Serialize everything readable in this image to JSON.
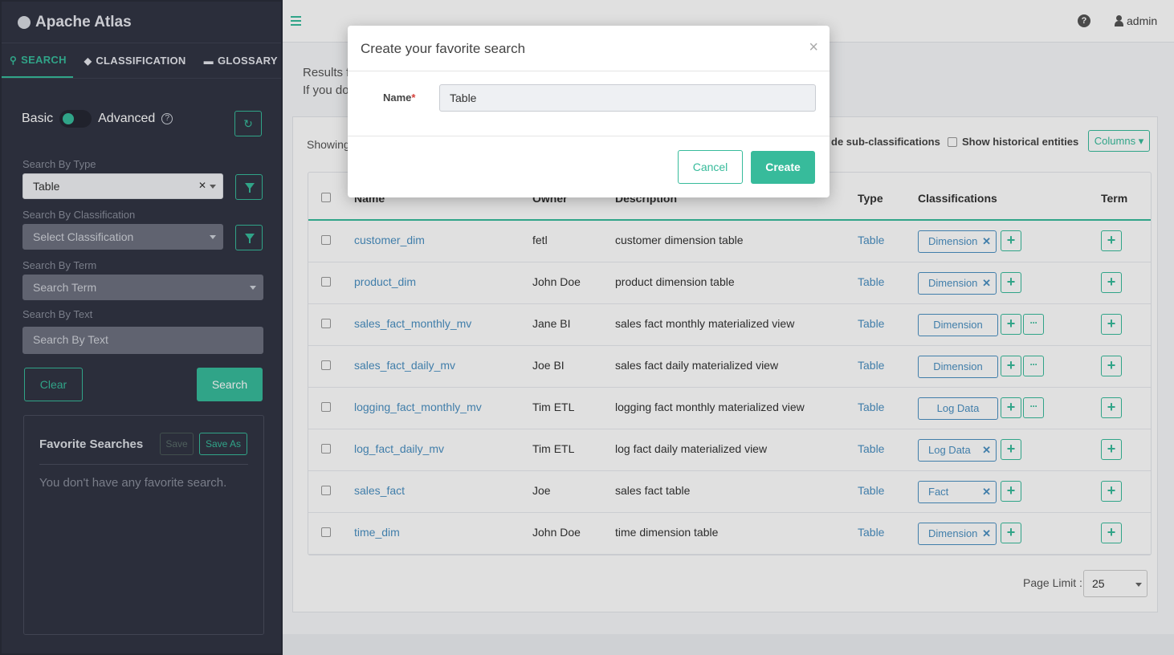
{
  "app": {
    "title": "Apache Atlas"
  },
  "sidebar": {
    "tabs": [
      {
        "label": "SEARCH",
        "icon": "search-icon",
        "active": true
      },
      {
        "label": "CLASSIFICATION",
        "icon": "tag-icon"
      },
      {
        "label": "GLOSSARY",
        "icon": "folder-icon"
      }
    ],
    "mode_basic": "Basic",
    "mode_advanced": "Advanced",
    "search_by_type_label": "Search By Type",
    "search_by_type_value": "Table",
    "search_by_classification_label": "Search By Classification",
    "search_by_classification_placeholder": "Select Classification",
    "search_by_term_label": "Search By Term",
    "search_by_term_placeholder": "Search Term",
    "search_by_text_label": "Search By Text",
    "search_by_text_placeholder": "Search By Text",
    "clear_label": "Clear",
    "search_label": "Search",
    "favorites": {
      "title": "Favorite Searches",
      "save_label": "Save",
      "save_as_label": "Save As",
      "empty_text": "You don't have any favorite search."
    }
  },
  "header": {
    "user": "admin"
  },
  "main": {
    "results_line1": "Results f",
    "results_line2": "If you do",
    "showing": "Showing",
    "include_sub_label": "de sub-classifications",
    "historical_label": "Show historical entities",
    "columns_label": "Columns",
    "columns": [
      "Name",
      "Owner",
      "Description",
      "Type",
      "Classifications",
      "Term"
    ],
    "rows": [
      {
        "name": "customer_dim",
        "owner": "fetl",
        "description": "customer dimension table",
        "type": "Table",
        "classification": "Dimension",
        "removable": true,
        "more": false
      },
      {
        "name": "product_dim",
        "owner": "John Doe",
        "description": "product dimension table",
        "type": "Table",
        "classification": "Dimension",
        "removable": true,
        "more": false
      },
      {
        "name": "sales_fact_monthly_mv",
        "owner": "Jane BI",
        "description": "sales fact monthly materialized view",
        "type": "Table",
        "classification": "Dimension",
        "removable": false,
        "more": true
      },
      {
        "name": "sales_fact_daily_mv",
        "owner": "Joe BI",
        "description": "sales fact daily materialized view",
        "type": "Table",
        "classification": "Dimension",
        "removable": false,
        "more": true
      },
      {
        "name": "logging_fact_monthly_mv",
        "owner": "Tim ETL",
        "description": "logging fact monthly materialized view",
        "type": "Table",
        "classification": "Log Data",
        "removable": false,
        "more": true
      },
      {
        "name": "log_fact_daily_mv",
        "owner": "Tim ETL",
        "description": "log fact daily materialized view",
        "type": "Table",
        "classification": "Log Data",
        "removable": true,
        "more": false
      },
      {
        "name": "sales_fact",
        "owner": "Joe",
        "description": "sales fact table",
        "type": "Table",
        "classification": "Fact",
        "removable": true,
        "more": false
      },
      {
        "name": "time_dim",
        "owner": "John Doe",
        "description": "time dimension table",
        "type": "Table",
        "classification": "Dimension",
        "removable": true,
        "more": false
      }
    ],
    "page_limit_label": "Page Limit :",
    "page_limit_value": "25"
  },
  "modal": {
    "title": "Create your favorite search",
    "name_label": "Name",
    "required_mark": "*",
    "name_value": "Table",
    "cancel_label": "Cancel",
    "create_label": "Create"
  },
  "colors": {
    "accent": "#37bb9b",
    "sidebar_bg": "#323544",
    "link": "#4a90c2"
  }
}
